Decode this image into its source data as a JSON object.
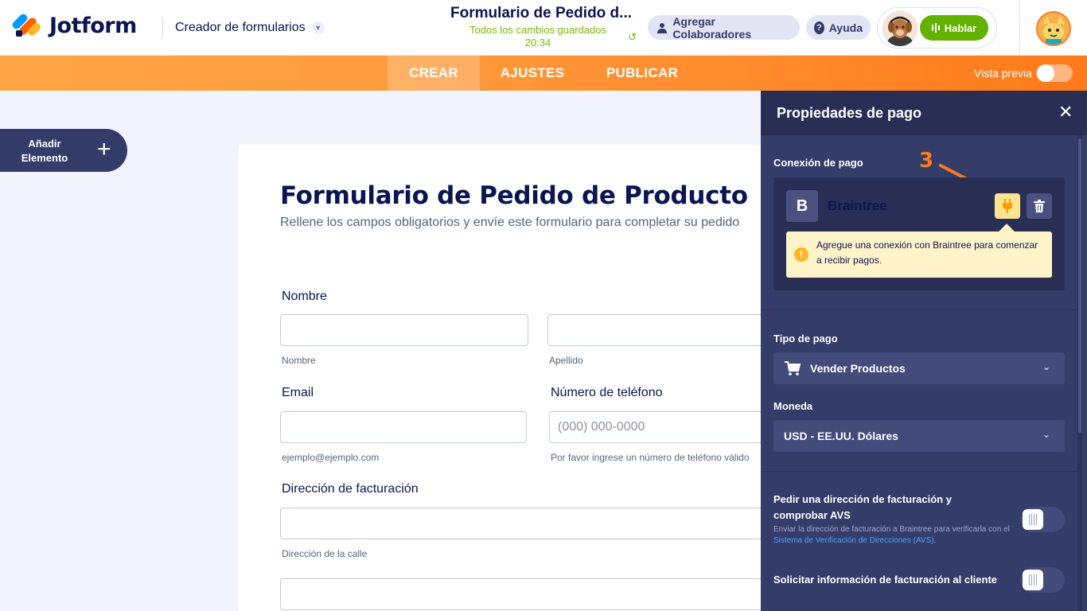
{
  "header": {
    "logo_text": "Jotform",
    "builder_title": "Creador de formularios",
    "form_title": "Formulario de Pedido d...",
    "save_status": "Todos los cambios guardados",
    "save_time": "20:34",
    "collaborators_label": "Agregar Colaboradores",
    "help_label": "Ayuda",
    "talk_label": "Hablar"
  },
  "nav": {
    "tabs": [
      {
        "label": "CREAR",
        "active": true
      },
      {
        "label": "AJUSTES",
        "active": false
      },
      {
        "label": "PUBLICAR",
        "active": false
      }
    ],
    "preview_label": "Vista previa",
    "preview_on": false
  },
  "sidebar": {
    "add_label": "Añadir Elemento"
  },
  "form": {
    "title": "Formulario de Pedido de Producto",
    "subtitle": "Rellene los campos obligatorios y envíe este formulario para completar su pedido",
    "name_label": "Nombre",
    "first_hint": "Nombre",
    "last_hint": "Apellido",
    "email_label": "Email",
    "email_hint": "ejemplo@ejemplo.com",
    "phone_label": "Número de teléfono",
    "phone_placeholder": "(000) 000-0000",
    "phone_hint": "Por favor ingrese un número de teléfono válido",
    "address_label": "Dirección de facturación",
    "street_hint": "Dirección de la calle"
  },
  "panel": {
    "title": "Propiedades de pago",
    "connection_label": "Conexión de pago",
    "step_marker": "3",
    "gateway_initial": "B",
    "gateway_name": "Braintree",
    "warning": "Agregue una conexión con Braintree para comenzar a recibir pagos.",
    "payment_type_label": "Tipo de pago",
    "payment_type_value": "Vender Productos",
    "currency_label": "Moneda",
    "currency_value": "USD - EE.UU. Dólares",
    "avs_label": "Pedir una dirección de facturación y comprobar AVS",
    "avs_desc": "Enviar la dirección de facturación a Braintree para verificarla con el",
    "avs_link": "Sistema de Verificación de Direcciones (AVS)",
    "avs_period": ".",
    "billing_info_label": "Solicitar información de facturación al cliente"
  },
  "colors": {
    "accent_orange": "#ff7a1a",
    "navy": "#0a1551",
    "panel_bg": "#343c6a",
    "talk_green": "#64b200",
    "saved_green": "#78bb07"
  }
}
